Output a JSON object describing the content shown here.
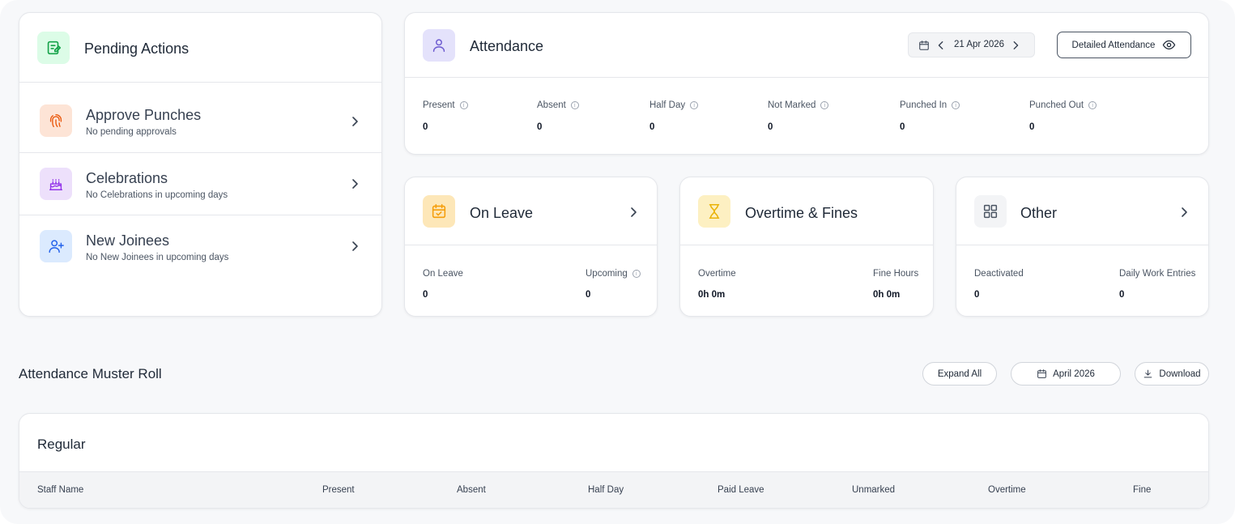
{
  "pending_actions": {
    "title": "Pending Actions",
    "items": [
      {
        "title": "Approve Punches",
        "subtitle": "No pending approvals"
      },
      {
        "title": "Celebrations",
        "subtitle": "No Celebrations in upcoming days"
      },
      {
        "title": "New Joinees",
        "subtitle": "No New Joinees in upcoming days"
      }
    ]
  },
  "attendance": {
    "title": "Attendance",
    "date": "21 Apr 2026",
    "detailed_button": "Detailed Attendance",
    "stats": [
      {
        "label": "Present",
        "value": "0"
      },
      {
        "label": "Absent",
        "value": "0"
      },
      {
        "label": "Half Day",
        "value": "0"
      },
      {
        "label": "Not Marked",
        "value": "0"
      },
      {
        "label": "Punched In",
        "value": "0"
      },
      {
        "label": "Punched Out",
        "value": "0"
      }
    ]
  },
  "on_leave": {
    "title": "On Leave",
    "stats": [
      {
        "label": "On Leave",
        "value": "0"
      },
      {
        "label": "Upcoming",
        "value": "0"
      }
    ]
  },
  "overtime": {
    "title": "Overtime & Fines",
    "stats": [
      {
        "label": "Overtime",
        "value": "0h 0m"
      },
      {
        "label": "Fine Hours",
        "value": "0h 0m"
      }
    ]
  },
  "other": {
    "title": "Other",
    "stats": [
      {
        "label": "Deactivated",
        "value": "0"
      },
      {
        "label": "Daily Work Entries",
        "value": "0"
      }
    ]
  },
  "muster": {
    "title": "Attendance Muster Roll",
    "expand_all": "Expand All",
    "month": "April 2026",
    "download": "Download",
    "group_title": "Regular",
    "columns": [
      "Staff Name",
      "Present",
      "Absent",
      "Half Day",
      "Paid Leave",
      "Unmarked",
      "Overtime",
      "Fine"
    ]
  },
  "colors": {
    "pending_icon_bg": "#dcfce7",
    "pending_icon": "#16a34a",
    "punch_icon_bg": "#fde4d6",
    "punch_icon": "#ea580c",
    "celebration_icon_bg": "#ede0fb",
    "celebration_icon": "#9333ea",
    "joinee_icon_bg": "#dbeafe",
    "joinee_icon": "#2563eb",
    "attendance_icon_bg": "#e4e2fb",
    "attendance_icon": "#6d5bd0",
    "leave_icon_bg": "#fde7b8",
    "leave_icon": "#f59e0b",
    "overtime_icon_bg": "#fdf0c2",
    "overtime_icon": "#eab308",
    "other_icon_bg": "#f3f4f6",
    "other_icon": "#4b5563"
  }
}
